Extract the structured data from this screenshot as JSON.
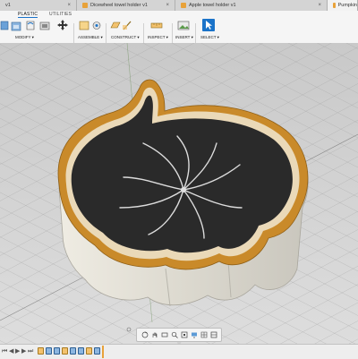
{
  "tabs": [
    {
      "label": "v1"
    },
    {
      "label": "Dicewheel towel holder v1"
    },
    {
      "label": "Apple towel holder v1"
    },
    {
      "label": "Pumpkin"
    }
  ],
  "workspace_tabs": [
    "PLASTIC",
    "UTILITIES"
  ],
  "toolbar": {
    "modify": "MODIFY ▾",
    "assemble": "ASSEMBLE ▾",
    "construct": "CONSTRUCT ▾",
    "inspect": "INSPECT ▾",
    "insert": "INSERT ▾",
    "select": "SELECT ▾"
  },
  "colors": {
    "accent": "#1a73c9",
    "model_rim": "#c98a2a",
    "model_body": "#e7e5dc",
    "model_top": "#2a2a2a"
  },
  "navbar_icons": [
    "orbit-icon",
    "pan-icon",
    "look-at-icon",
    "zoom-icon",
    "fit-icon",
    "display-icon",
    "grid-icon",
    "viewport-icon"
  ],
  "timeline_icons": [
    "skip-start-icon",
    "step-back-icon",
    "play-icon",
    "step-forward-icon",
    "skip-end-icon"
  ]
}
